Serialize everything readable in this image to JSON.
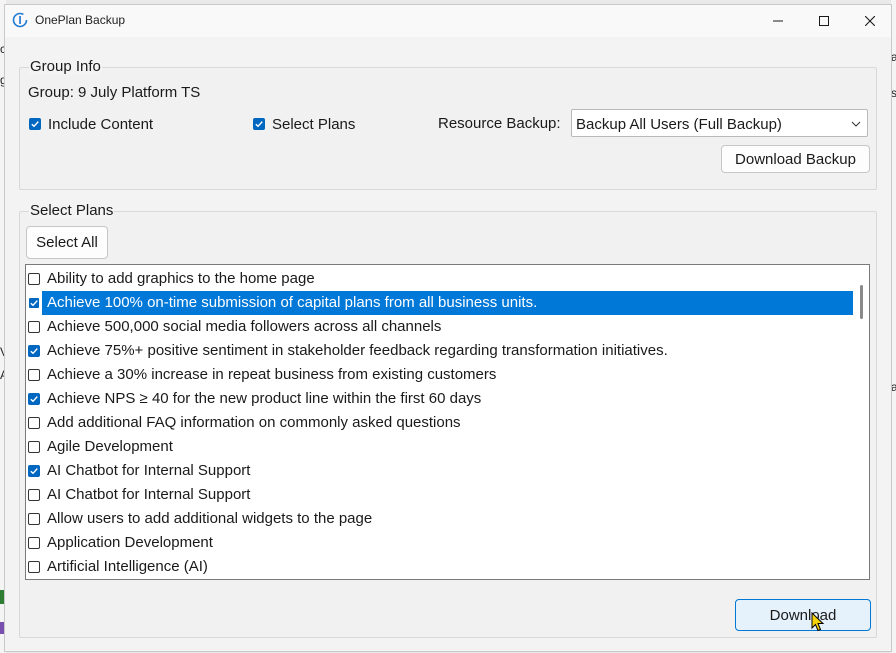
{
  "window": {
    "title": "OnePlan Backup",
    "controls": {
      "minimize": "minimize-icon",
      "maximize": "maximize-icon",
      "close": "close-icon"
    }
  },
  "background_fragments": {
    "left": [
      "c",
      "g",
      "V",
      "A"
    ],
    "right": [
      "a",
      "s",
      "a"
    ]
  },
  "group_info": {
    "legend": "Group Info",
    "group_label": "Group: 9 July Platform TS",
    "include_content": {
      "label": "Include Content",
      "checked": true
    },
    "select_plans": {
      "label": "Select Plans",
      "checked": true
    },
    "resource_backup_label": "Resource Backup:",
    "resource_backup_value": "Backup All Users (Full Backup)",
    "download_backup_label": "Download Backup"
  },
  "select_plans_section": {
    "legend": "Select Plans",
    "select_all_label": "Select All",
    "plans": [
      {
        "label": "Ability to add graphics to the home page",
        "checked": false,
        "selected": false
      },
      {
        "label": "Achieve 100% on-time submission of capital plans from all business units.",
        "checked": true,
        "selected": true
      },
      {
        "label": "Achieve 500,000 social media followers across all channels",
        "checked": false,
        "selected": false
      },
      {
        "label": "Achieve 75%+ positive sentiment in stakeholder feedback regarding transformation initiatives.",
        "checked": true,
        "selected": false
      },
      {
        "label": "Achieve a 30% increase in repeat business from existing customers",
        "checked": false,
        "selected": false
      },
      {
        "label": "Achieve NPS ≥ 40 for the new product line within the first 60 days",
        "checked": true,
        "selected": false
      },
      {
        "label": "Add additional FAQ information on commonly asked questions",
        "checked": false,
        "selected": false
      },
      {
        "label": "Agile Development",
        "checked": false,
        "selected": false
      },
      {
        "label": "AI Chatbot for Internal Support",
        "checked": true,
        "selected": false
      },
      {
        "label": "AI Chatbot for Internal Support",
        "checked": false,
        "selected": false
      },
      {
        "label": "Allow users to add additional widgets to the page",
        "checked": false,
        "selected": false
      },
      {
        "label": "Application Development",
        "checked": false,
        "selected": false
      },
      {
        "label": "Artificial Intelligence (AI)",
        "checked": false,
        "selected": false
      }
    ],
    "download_label": "Download"
  },
  "colors": {
    "accent": "#0067c0",
    "selection": "#0078d7",
    "window_bg": "#f3f3f3"
  }
}
